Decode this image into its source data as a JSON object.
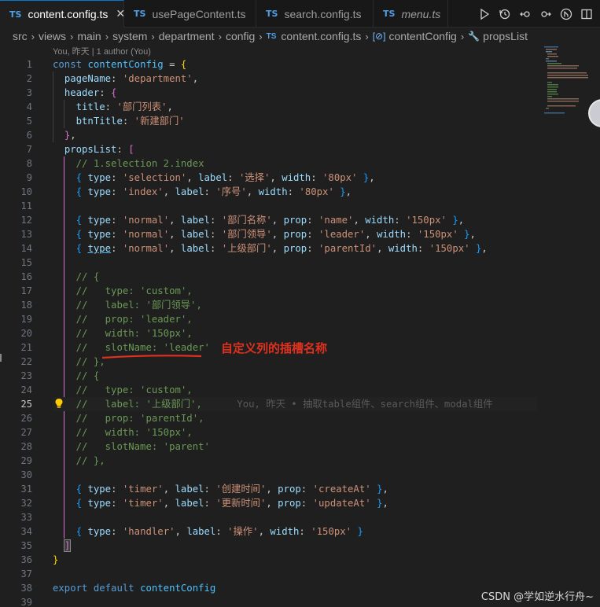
{
  "tabs": [
    {
      "label": "content.config.ts",
      "active": true,
      "icon": "typescript-icon",
      "badge": "TS"
    },
    {
      "label": "usePageContent.ts",
      "active": false,
      "icon": "typescript-icon",
      "badge": "TS"
    },
    {
      "label": "search.config.ts",
      "active": false,
      "icon": "typescript-icon",
      "badge": "TS"
    },
    {
      "label": "menu.ts",
      "active": false,
      "icon": "typescript-icon",
      "badge": "TS",
      "italic": true
    }
  ],
  "tab_actions": [
    "run-icon",
    "history-icon",
    "go-back-icon",
    "go-forward-icon",
    "git-compare-icon",
    "split-editor-icon"
  ],
  "breadcrumb": {
    "folders": [
      "src",
      "views",
      "main",
      "system",
      "department",
      "config"
    ],
    "file": "content.config.ts",
    "symbol": "contentConfig",
    "property": "propsList",
    "file_badge": "TS"
  },
  "blame_header": "You, 昨天 | 1 author (You)",
  "current_line": 25,
  "inline_blame": "You, 昨天 • 抽取table组件、search组件、modal组件",
  "annotation": "自定义列的插槽名称",
  "watermark": "CSDN @学如逆水行舟~",
  "code_lines": [
    "const contentConfig = {",
    "  pageName: 'department',",
    "  header: {",
    "    title: '部门列表',",
    "    btnTitle: '新建部门'",
    "  },",
    "  propsList: [",
    "    // 1.selection 2.index",
    "    { type: 'selection', label: '选择', width: '80px' },",
    "    { type: 'index', label: '序号', width: '80px' },",
    "",
    "    { type: 'normal', label: '部门名称', prop: 'name', width: '150px' },",
    "    { type: 'normal', label: '部门领导', prop: 'leader', width: '150px' },",
    "    { type: 'normal', label: '上级部门', prop: 'parentId', width: '150px' },",
    "",
    "    // {",
    "    //   type: 'custom',",
    "    //   label: '部门领导',",
    "    //   prop: 'leader',",
    "    //   width: '150px',",
    "    //   slotName: 'leader'",
    "    // },",
    "    // {",
    "    //   type: 'custom',",
    "    //   label: '上级部门',",
    "    //   prop: 'parentId',",
    "    //   width: '150px',",
    "    //   slotName: 'parent'",
    "    // },",
    "",
    "    { type: 'timer', label: '创建时间', prop: 'createAt' },",
    "    { type: 'timer', label: '更新时间', prop: 'updateAt' },",
    "",
    "    { type: 'handler', label: '操作', width: '150px' }",
    "  ]",
    "}",
    "",
    "export default contentConfig",
    ""
  ]
}
